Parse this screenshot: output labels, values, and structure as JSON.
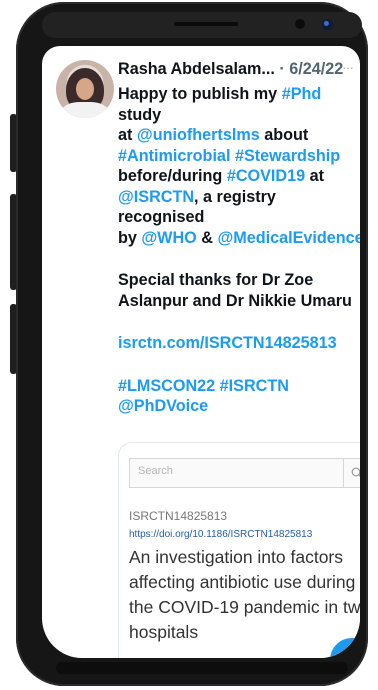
{
  "tweet": {
    "author": "Rasha Abdelsalam...",
    "meta": " · 6/24/22",
    "more": "···",
    "lines": [
      [
        {
          "t": "Happy to publish my ",
          "c": "text"
        },
        {
          "t": "#Phd",
          "c": "link"
        },
        {
          "t": " study",
          "c": "text"
        }
      ],
      [
        {
          "t": "at ",
          "c": "text"
        },
        {
          "t": "@uniofhertslms",
          "c": "link"
        },
        {
          "t": " about",
          "c": "text"
        }
      ],
      [
        {
          "t": "#Antimicrobial",
          "c": "link"
        },
        {
          "t": " ",
          "c": "text"
        },
        {
          "t": "#Stewardship",
          "c": "link"
        }
      ],
      [
        {
          "t": "before/during ",
          "c": "text"
        },
        {
          "t": "#COVID19",
          "c": "link"
        },
        {
          "t": " at",
          "c": "text"
        }
      ],
      [
        {
          "t": "@ISRCTN",
          "c": "link"
        },
        {
          "t": ", a registry recognised",
          "c": "text"
        }
      ],
      [
        {
          "t": "by ",
          "c": "text"
        },
        {
          "t": "@WHO",
          "c": "link"
        },
        {
          "t": " & ",
          "c": "text"
        },
        {
          "t": "@MedicalEvidence",
          "c": "link"
        }
      ]
    ],
    "thanks_1": "Special thanks for Dr Zoe",
    "thanks_2": "Aslanpur and Dr Nikkie Umaru",
    "url": "isrctn.com/ISRCTN14825813",
    "tags_1": "#LMSCON22 #ISRCTN",
    "tags_2": "@PhDVoice"
  },
  "card": {
    "search_placeholder": "Search",
    "registration_id": "ISRCTN14825813",
    "doi": "https://doi.org/10.1186/ISRCTN14825813",
    "title": "An investigation into factors affecting antibiotic use during the COVID-19 pandemic in two hospitals"
  },
  "icons": {
    "search": "search-icon",
    "more": "more-icon",
    "compose": "compose-fab"
  },
  "colors": {
    "link": "#1d9bf0",
    "text": "#0f1419",
    "meta": "#536471",
    "doi": "#1f5fa8"
  }
}
